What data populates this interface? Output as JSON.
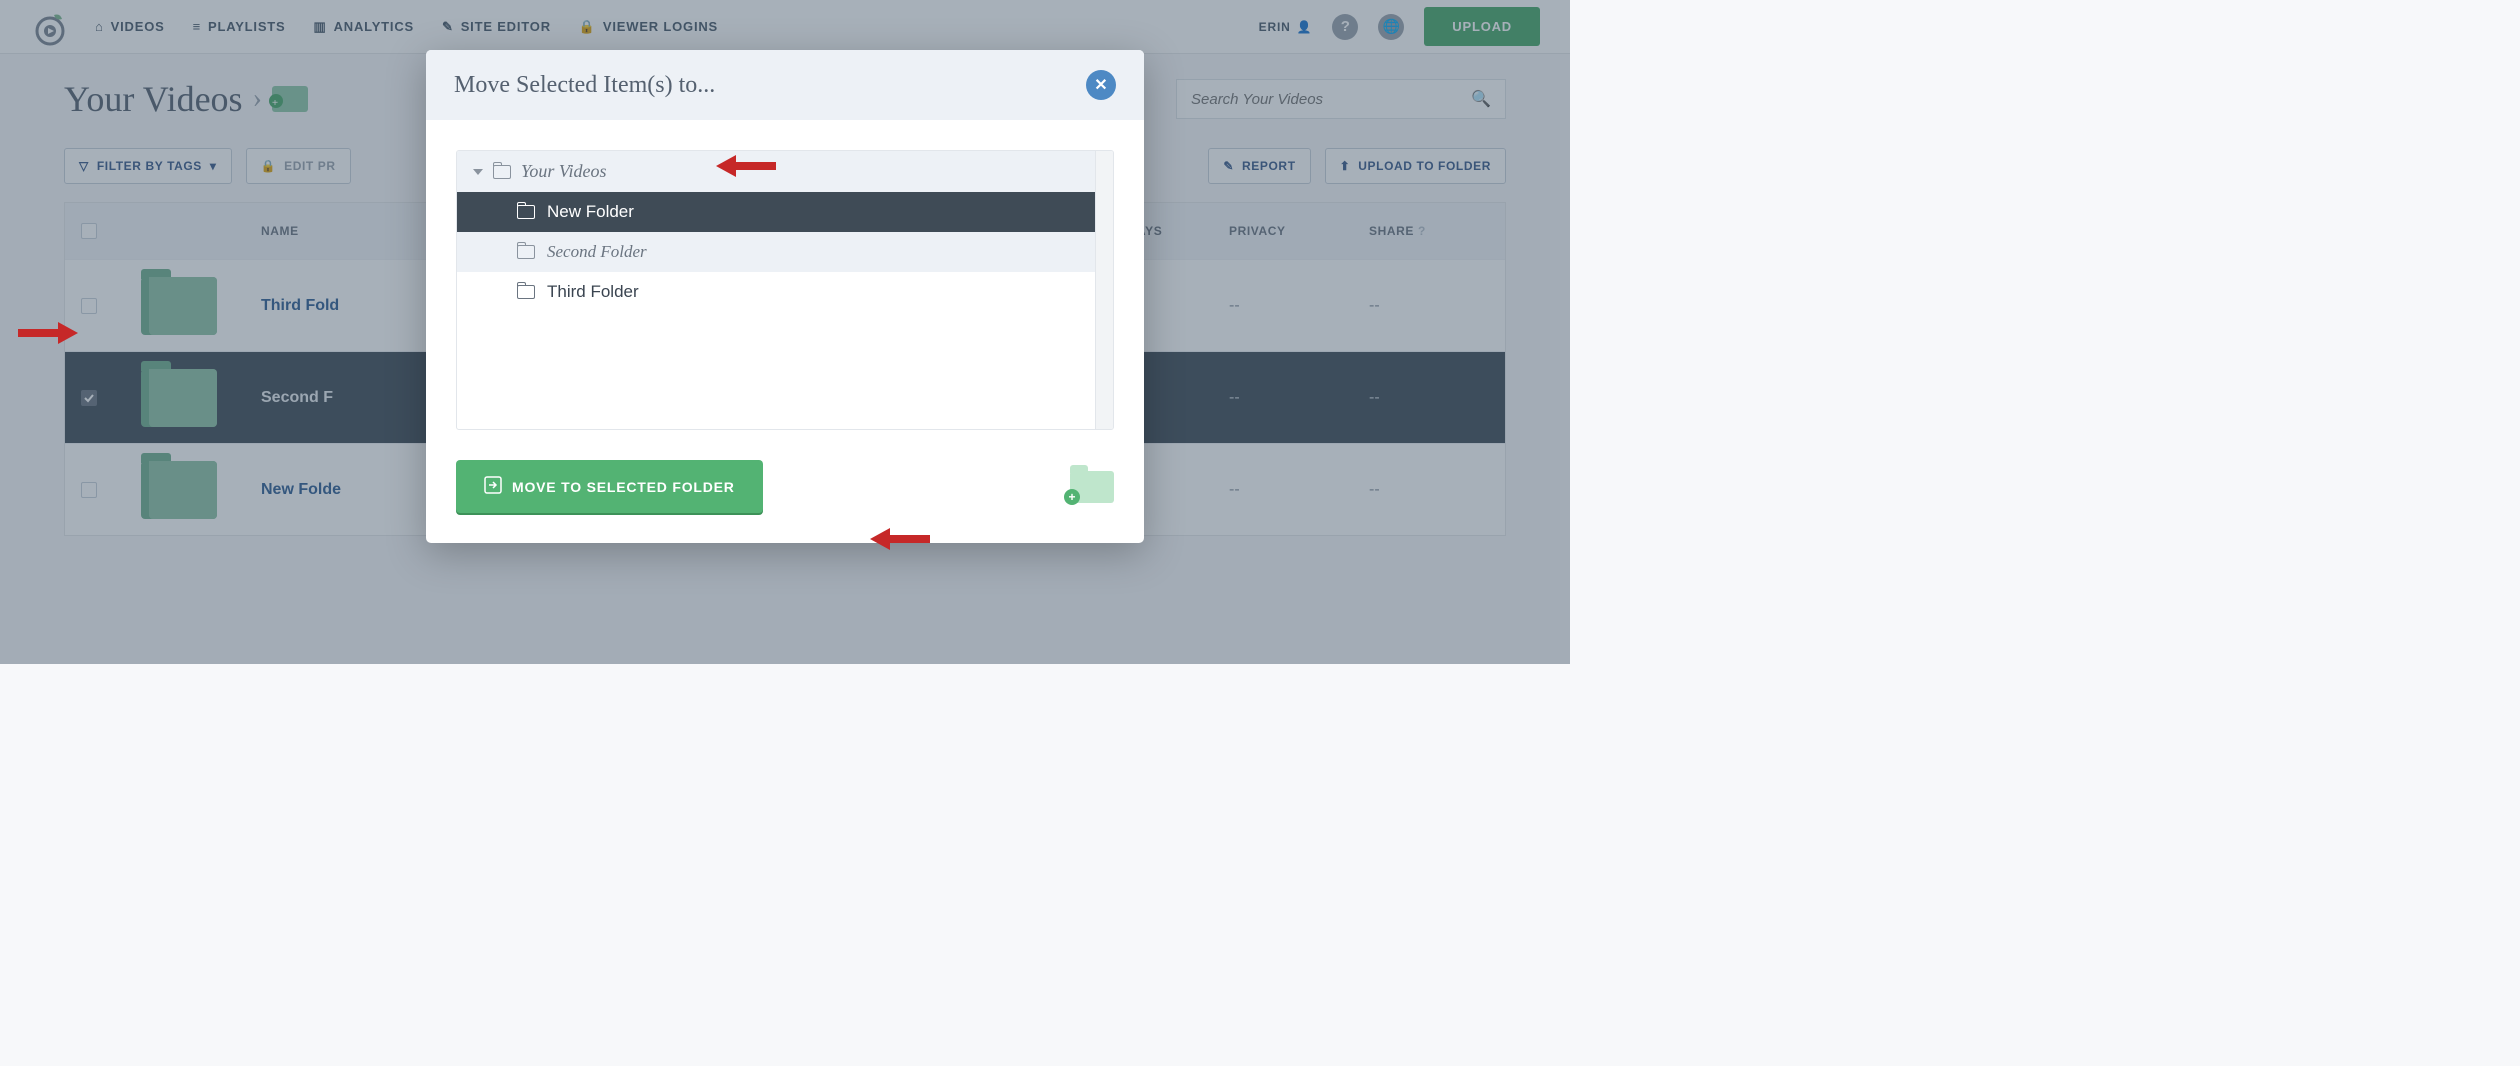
{
  "nav": {
    "items": [
      {
        "label": "VIDEOS"
      },
      {
        "label": "PLAYLISTS"
      },
      {
        "label": "ANALYTICS"
      },
      {
        "label": "SITE EDITOR"
      },
      {
        "label": "VIEWER LOGINS"
      }
    ],
    "user": "ERIN",
    "upload": "UPLOAD"
  },
  "page": {
    "title": "Your Videos",
    "search_placeholder": "Search Your Videos"
  },
  "toolbar": {
    "filter": "FILTER BY TAGS",
    "edit": "EDIT PR",
    "report": "REPORT",
    "upload_folder": "UPLOAD TO FOLDER"
  },
  "table": {
    "headers": {
      "name": "NAME",
      "plays_h": "LAYS",
      "privacy": "PRIVACY",
      "share": "SHARE"
    },
    "rows": [
      {
        "name": "Third Fold",
        "selected": false,
        "plays": "--",
        "privacy": "--",
        "share": "--"
      },
      {
        "name": "Second F",
        "selected": true,
        "plays": "--",
        "privacy": "--",
        "share": "--"
      },
      {
        "name": "New Folde",
        "selected": false,
        "plays": "--",
        "privacy": "--",
        "share": "--"
      }
    ]
  },
  "modal": {
    "title": "Move Selected Item(s) to...",
    "root": "Your Videos",
    "folders": [
      {
        "name": "New Folder",
        "state": "selected"
      },
      {
        "name": "Second Folder",
        "state": "alt"
      },
      {
        "name": "Third Folder",
        "state": "plain"
      }
    ],
    "move_label": "MOVE TO SELECTED FOLDER"
  }
}
